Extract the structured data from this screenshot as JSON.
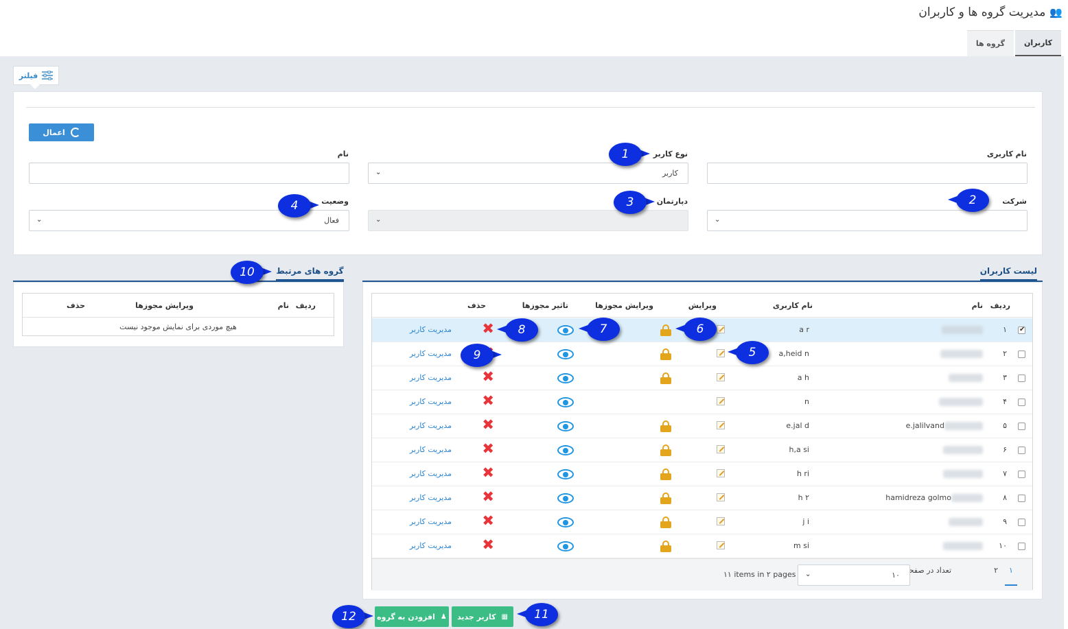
{
  "header": {
    "title": "مدیریت گروه ها و کاربران",
    "title_icon": "users-icon",
    "tabs": [
      {
        "label": "کاربران",
        "active": true
      },
      {
        "label": "گروه ها",
        "active": false
      }
    ]
  },
  "filter": {
    "toggle_label": "فیلتر",
    "apply_label": "اعمال",
    "fields": {
      "username_label": "نام کاربری",
      "username_value": "",
      "user_type_label": "نوع کاربر",
      "user_type_value": "کاربر",
      "name_label": "نام",
      "name_value": "",
      "company_label": "شرکت",
      "company_value": "",
      "department_label": "دپارتمان",
      "department_value": "",
      "status_label": "وضعیت",
      "status_value": "فعال"
    }
  },
  "users_panel": {
    "tab_label": "لیست کاربران",
    "columns": {
      "row": "ردیف",
      "name": "نام",
      "username": "نام کاربری",
      "edit": "ویرایش",
      "edit_permissions": "ویرایش مجوزها",
      "permission_effect": "تاثیر مجوزها",
      "delete": "حذف"
    },
    "manage_link_label": "مدیریت کاربر",
    "rows": [
      {
        "index": "۱",
        "name_visible": "",
        "username_visible": "a    r",
        "checked": true,
        "has_lock": true
      },
      {
        "index": "۲",
        "name_visible": "",
        "username_visible": "a,heid      n",
        "checked": false,
        "has_lock": true
      },
      {
        "index": "۳",
        "name_visible": "",
        "username_visible": "a      h",
        "checked": false,
        "has_lock": true
      },
      {
        "index": "۴",
        "name_visible": "",
        "username_visible": "      n",
        "checked": false,
        "has_lock": false
      },
      {
        "index": "۵",
        "name_visible": "e.jalilvand",
        "username_visible": "e.jal      d",
        "checked": false,
        "has_lock": true
      },
      {
        "index": "۶",
        "name_visible": "",
        "username_visible": "h,a      si",
        "checked": false,
        "has_lock": true
      },
      {
        "index": "۷",
        "name_visible": "",
        "username_visible": "h      ri",
        "checked": false,
        "has_lock": true
      },
      {
        "index": "۸",
        "name_visible": "hamidreza golmo",
        "username_visible": "h      ۲",
        "checked": false,
        "has_lock": true
      },
      {
        "index": "۹",
        "name_visible": "",
        "username_visible": "j      i",
        "checked": false,
        "has_lock": true
      },
      {
        "index": "۱۰",
        "name_visible": "",
        "username_visible": "m      si",
        "checked": false,
        "has_lock": true
      }
    ],
    "pager": {
      "pages": [
        "۱",
        "۲"
      ],
      "current_page": "۱",
      "page_size_label": "تعداد در صفحه",
      "page_size_value": "۱۰",
      "summary": "۱۱ items in ۲ pages"
    }
  },
  "groups_panel": {
    "tab_label": "گروه های مرتبط",
    "columns": {
      "row": "ردیف",
      "name": "نام",
      "edit_permissions": "ویرایش مجوزها",
      "delete": "حذف"
    },
    "empty_message": "هیچ موردی برای نمایش موجود نیست"
  },
  "actions": {
    "new_user_label": "کاربر جدید",
    "add_to_group_label": "افزودن به گروه"
  },
  "callouts": [
    "1",
    "2",
    "3",
    "4",
    "5",
    "6",
    "7",
    "8",
    "9",
    "10",
    "11",
    "12"
  ],
  "colors": {
    "primary": "#3b8fd6",
    "success": "#3dbd86",
    "danger": "#e8343b",
    "warning": "#e2a51b",
    "link": "#2a84d2",
    "callout": "#0d2fe0"
  }
}
